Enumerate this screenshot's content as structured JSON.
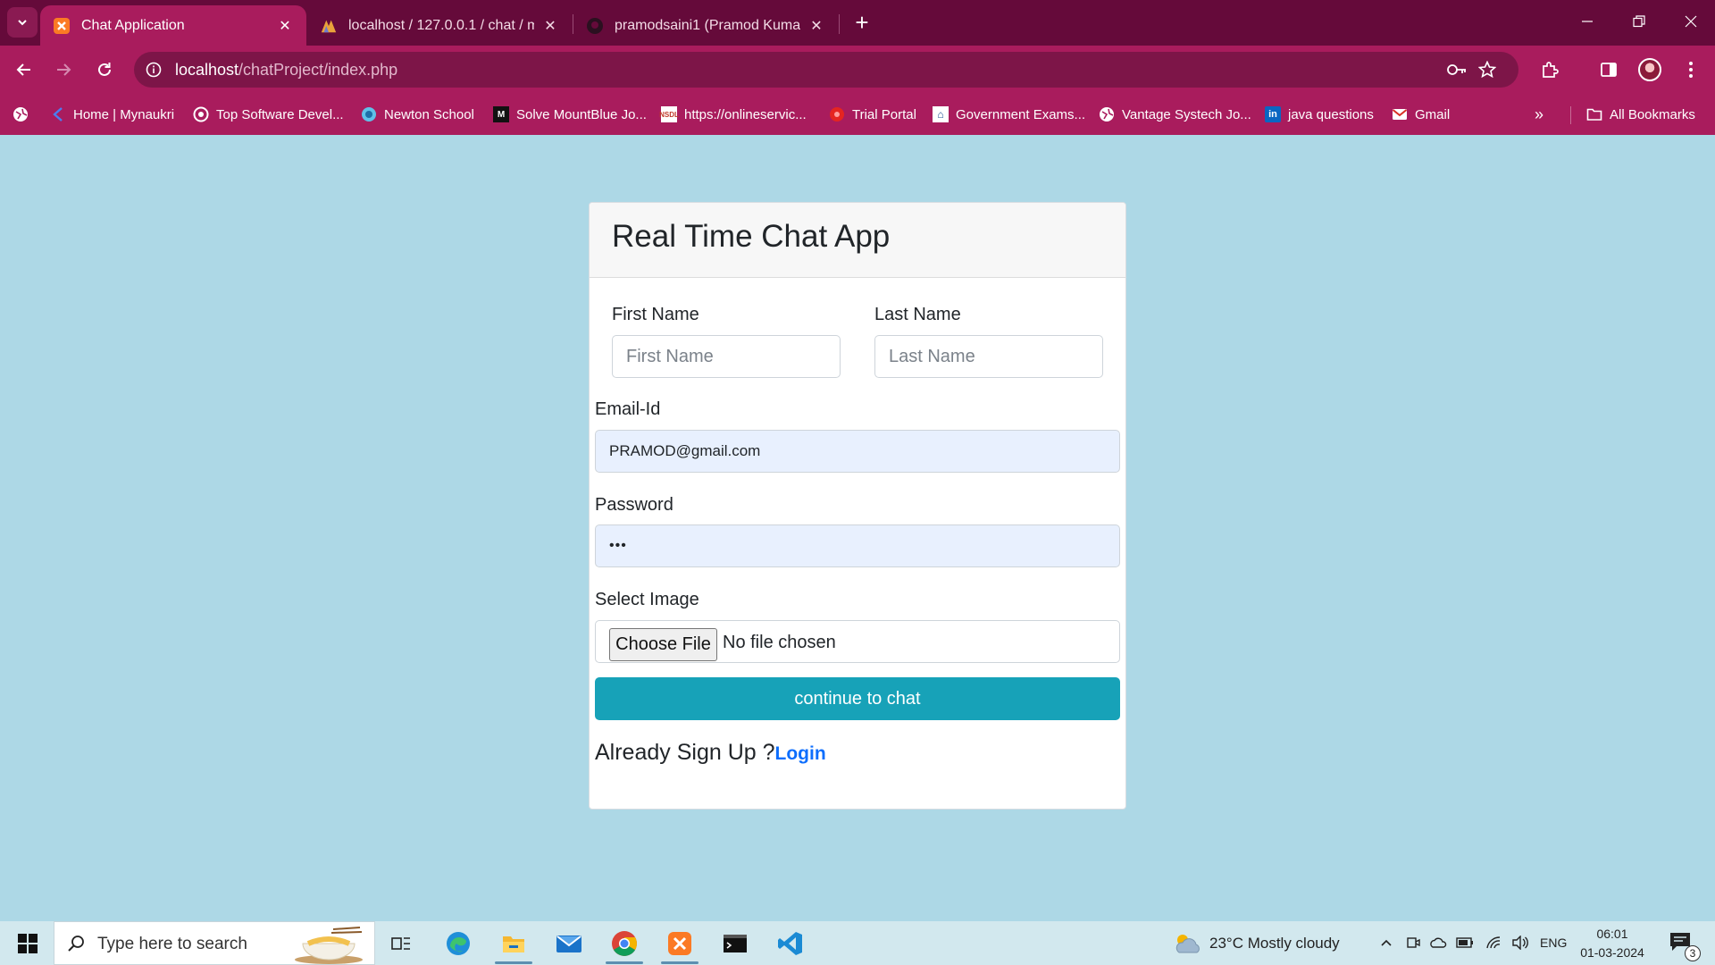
{
  "browser": {
    "tabs": [
      {
        "title": "Chat Application",
        "active": true
      },
      {
        "title": "localhost / 127.0.0.1 / chat / me",
        "active": false
      },
      {
        "title": "pramodsaini1 (Pramod Kumar S",
        "active": false
      }
    ],
    "url_host": "localhost",
    "url_path": "/chatProject/index.php",
    "bookmarks": [
      "Home | Mynaukri",
      "Top Software Devel...",
      "Newton School",
      "Solve MountBlue Jo...",
      "https://onlineservic...",
      "Trial Portal",
      "Government Exams...",
      "Vantage Systech Jo...",
      "java questions",
      "Gmail"
    ],
    "all_bookmarks": "All Bookmarks",
    "accent": "#a91c5d",
    "tabstrip_color": "#650a3a"
  },
  "form": {
    "title": "Real Time Chat App",
    "first_name_label": "First Name",
    "first_name_placeholder": "First Name",
    "last_name_label": "Last Name",
    "last_name_placeholder": "Last Name",
    "email_label": "Email-Id",
    "email_value": "PRAMOD@gmail.com",
    "password_label": "Password",
    "password_value": "•••",
    "image_label": "Select Image",
    "choose_file": "Choose File",
    "no_file": "No file chosen",
    "submit": "continue to chat",
    "already": "Already Sign Up ?",
    "login": "Login",
    "page_bg": "#add8e6",
    "button_color": "#17a2b8"
  },
  "taskbar": {
    "search_placeholder": "Type here to search",
    "weather": "23°C  Mostly cloudy",
    "lang": "ENG",
    "time": "06:01",
    "date": "01-03-2024",
    "notifications": "3"
  }
}
